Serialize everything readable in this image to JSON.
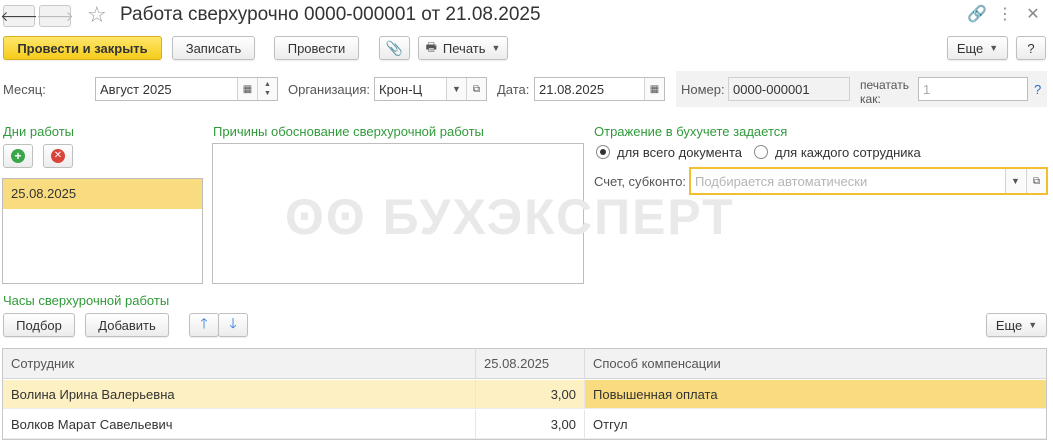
{
  "window": {
    "title": "Работа сверхурочно 0000-000001 от 21.08.2025"
  },
  "toolbar": {
    "post_close": "Провести и закрыть",
    "save": "Записать",
    "post": "Провести",
    "print": "Печать",
    "more": "Еще",
    "help": "?"
  },
  "header": {
    "month_label": "Месяц:",
    "month_value": "Август 2025",
    "org_label": "Организация:",
    "org_value": "Крон-Ц",
    "date_label": "Дата:",
    "date_value": "21.08.2025",
    "number_label": "Номер:",
    "number_value": "0000-000001",
    "print_as_label_1": "печатать",
    "print_as_label_2": "как:",
    "print_as_value": "1",
    "print_as_help": "?"
  },
  "work_days": {
    "title": "Дни работы",
    "items": [
      "25.08.2025"
    ]
  },
  "reasons": {
    "title": "Причины обоснование сверхурочной работы",
    "text": ""
  },
  "accounting": {
    "title": "Отражение в бухучете задается",
    "option_document": "для всего документа",
    "option_employee": "для каждого сотрудника",
    "selected": "document",
    "account_label": "Счет, субконто:",
    "account_placeholder": "Подбирается автоматически"
  },
  "overtime": {
    "title": "Часы сверхурочной работы",
    "pick": "Подбор",
    "add": "Добавить",
    "more": "Еще",
    "columns": [
      "Сотрудник",
      "25.08.2025",
      "Способ компенсации"
    ],
    "rows": [
      {
        "employee": "Волина Ирина Валерьевна",
        "hours": "3,00",
        "compensation": "Повышенная оплата"
      },
      {
        "employee": "Волков Марат Савельевич",
        "hours": "3,00",
        "compensation": "Отгул"
      }
    ]
  },
  "watermark": "БУХЭКСПЕРТ",
  "colors": {
    "accent_green": "#2f9a3a",
    "primary_button": "#f5cc1a",
    "selection": "#fdf0c2",
    "focus_border": "#f0c030"
  }
}
